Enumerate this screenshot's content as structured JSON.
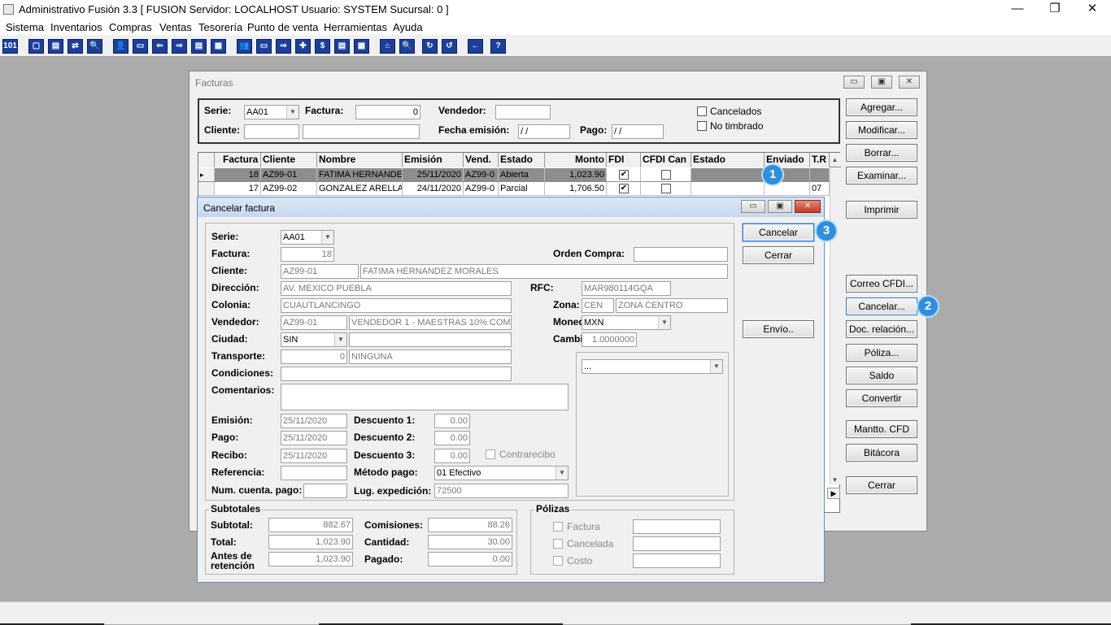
{
  "app": {
    "title": "Administrativo Fusión 3.3 [ FUSION  Servidor: LOCALHOST   Usuario: SYSTEM    Sucursal: 0 ]",
    "minimize": "—",
    "restore": "❐",
    "close": "✕"
  },
  "menu": [
    "Sistema",
    "Inventarios",
    "Compras",
    "Ventas",
    "Tesorería",
    "Punto de venta",
    "Herramientas",
    "Ayuda"
  ],
  "toolbar_icons": [
    "101",
    "▢",
    "▤",
    "⇄",
    "🔍",
    "👤",
    "▭",
    "⇐",
    "⇒",
    "▤",
    "▦",
    "👥",
    "▭",
    "⇒",
    "✚",
    "$",
    "▤",
    "▦",
    "⌂",
    "🔍",
    "↻",
    "↺",
    "←",
    "?"
  ],
  "facturas": {
    "title": "Facturas",
    "filters": {
      "serie_label": "Serie:",
      "serie_value": "AA01",
      "factura_label": "Factura:",
      "factura_value": "0",
      "vendedor_label": "Vendedor:",
      "vendedor_value": "",
      "cliente_label": "Cliente:",
      "fecha_label": "Fecha emisión:",
      "fecha_value": " / /",
      "pago_label": "Pago:",
      "pago_value": " / /",
      "cancelados": "Cancelados",
      "no_timbrado": "No timbrado"
    },
    "columns": [
      "Factura",
      "Cliente",
      "Nombre",
      "Emisión",
      "Vend.",
      "Estado",
      "Monto",
      "FDI",
      "CFDI Can",
      "Estado",
      "Enviado",
      "T.R"
    ],
    "rows": [
      {
        "marker": "▸",
        "factura": "18",
        "cliente": "AZ99-01",
        "nombre": "FATIMA HERNANDEZ",
        "emision": "25/11/2020",
        "vend": "AZ99-0",
        "estado": "Abierta",
        "monto": "1,023.90",
        "fdi": "✔",
        "cfdi": "",
        "estado2": "",
        "enviado": "",
        "tr": ""
      },
      {
        "marker": "",
        "factura": "17",
        "cliente": "AZ99-02",
        "nombre": "GONZALEZ ARELLAN",
        "emision": "24/11/2020",
        "vend": "AZ99-0",
        "estado": "Parcial",
        "monto": "1,706.50",
        "fdi": "✔",
        "cfdi": "",
        "estado2": "",
        "enviado": "",
        "tr": "07"
      }
    ],
    "buttons": [
      "Agregar...",
      "Modificar...",
      "Borrar...",
      "Examinar...",
      "Imprimir",
      "Correo CFDI...",
      "Cancelar...",
      "Doc. relación...",
      "Póliza...",
      "Saldo",
      "Convertir",
      "Mantto. CFD",
      "Bitácora",
      "Cerrar"
    ],
    "scroll_up": "▲",
    "scroll_down": "▼",
    "scroll_right": "▶"
  },
  "badges": {
    "one": "1",
    "two": "2",
    "three": "3"
  },
  "cancelar": {
    "title": "Cancelar factura",
    "serie_label": "Serie:",
    "serie": "AA01",
    "factura_label": "Factura:",
    "factura": "18",
    "orden_label": "Orden Compra:",
    "orden": "",
    "cliente_label": "Cliente:",
    "cliente_code": "AZ99-01",
    "cliente_name": "FATIMA HERNANDEZ MORALES",
    "direccion_label": "Dirección:",
    "direccion": "AV. MEXICO PUEBLA",
    "rfc_label": "RFC:",
    "rfc": "MAR980114GQA",
    "colonia_label": "Colonia:",
    "colonia": "CUAUTLANCINGO",
    "zona_label": "Zona:",
    "zona_code": "CEN",
    "zona_name": "ZONA CENTRO",
    "vendedor_label": "Vendedor:",
    "vendedor_code": "AZ99-01",
    "vendedor_name": "VENDEDOR 1 - MAESTRAS 10% COMISIÓN",
    "moneda_label": "Moneda:",
    "moneda": "MXN",
    "ciudad_label": "Ciudad:",
    "ciudad": "SIN",
    "ciudad_name": "",
    "cambio_label": "Cambio:",
    "cambio": "1.0000000",
    "transporte_label": "Transporte:",
    "transporte_num": "0",
    "transporte_name": "NINGUNA",
    "condiciones_label": "Condiciones:",
    "condiciones": "",
    "comentarios_label": "Comentarios:",
    "comentarios": "",
    "extra_select": "...",
    "emision_label": "Emisión:",
    "emision": "25/11/2020",
    "pago_label": "Pago:",
    "pago": "25/11/2020",
    "recibo_label": "Recibo:",
    "recibo": "25/11/2020",
    "referencia_label": "Referencia:",
    "referencia": "",
    "numcta_label": "Num. cuenta. pago:",
    "numcta": "",
    "desc1_label": "Descuento 1:",
    "desc1": "0.00",
    "desc2_label": "Descuento 2:",
    "desc2": "0.00",
    "desc3_label": "Descuento 3:",
    "desc3": "0.00",
    "contrarecibo": "Contrarecibo",
    "metodo_label": "Método pago:",
    "metodo": "01 Efectivo",
    "lugexp_label": "Lug. expedición:",
    "lugexp": "72500",
    "subtotales_label": "Subtotales",
    "subtotal_label": "Subtotal:",
    "subtotal": "882.67",
    "comisiones_label": "Comisiones:",
    "comisiones": "88.26",
    "total_label": "Total:",
    "total": "1,023.90",
    "cantidad_label": "Cantidad:",
    "cantidad": "30.00",
    "antes_label_1": "Antes de",
    "antes_label_2": "retención",
    "antes": "1,023.90",
    "pagado_label": "Pagado:",
    "pagado": "0.00",
    "polizas_label": "Pólizas",
    "poliza_factura": "Factura",
    "poliza_cancelada": "Cancelada",
    "poliza_costo": "Costo",
    "btn_cancelar": "Cancelar",
    "btn_cerrar": "Cerrar",
    "btn_envio": "Envío.."
  }
}
